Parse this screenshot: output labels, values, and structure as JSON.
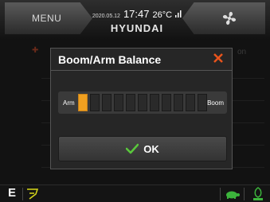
{
  "top_bar": {
    "menu_label": "MENU",
    "date": "2020.05.12",
    "time": "17:47",
    "temperature": "26°C",
    "brand": "HYUNDAI",
    "fan_icon": "fan-icon",
    "signal_icon": "signal-icon"
  },
  "background": {
    "header_fragment": "on"
  },
  "dialog": {
    "title": "Boom/Arm Balance",
    "close_icon": "close-icon",
    "slider": {
      "left_label": "Arm",
      "right_label": "Boom",
      "segment_count": 11,
      "active_segment_index": 0
    },
    "ok_label": "OK",
    "ok_icon": "check-icon"
  },
  "bottom_bar": {
    "mode_label": "E",
    "bucket_icon": "bucket-icon",
    "turtle_icon": "turtle-icon",
    "eco_icon": "eco-icon"
  },
  "colors": {
    "accent_orange": "#f0a020",
    "close_red": "#e8541c",
    "check_green": "#5ac83c"
  }
}
